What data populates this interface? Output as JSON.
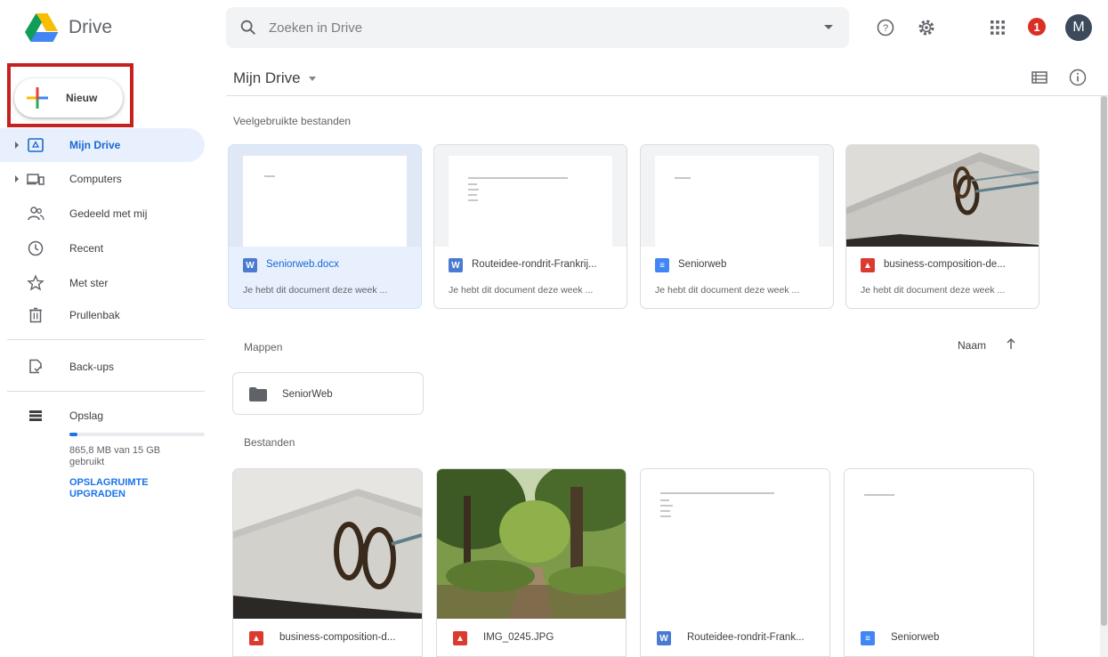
{
  "app": {
    "name": "Drive"
  },
  "search": {
    "placeholder": "Zoeken in Drive"
  },
  "header": {
    "notifications_count": "1",
    "avatar_letter": "M"
  },
  "sidebar": {
    "new_label": "Nieuw",
    "items": [
      {
        "label": "Mijn Drive",
        "icon": "my-drive-icon",
        "active": true
      },
      {
        "label": "Computers",
        "icon": "computers-icon"
      },
      {
        "label": "Gedeeld met mij",
        "icon": "shared-icon"
      },
      {
        "label": "Recent",
        "icon": "clock-icon"
      },
      {
        "label": "Met ster",
        "icon": "star-icon"
      },
      {
        "label": "Prullenbak",
        "icon": "trash-icon"
      },
      {
        "label": "Back-ups",
        "icon": "backup-icon"
      },
      {
        "label": "Opslag",
        "icon": "storage-icon"
      }
    ],
    "storage": {
      "used_text": "865,8 MB van 15 GB gebruikt",
      "fraction": 0.058,
      "upgrade_label": "OPSLAGRUIMTE UPGRADEN"
    }
  },
  "main": {
    "title": "Mijn Drive",
    "quick_access_label": "Veelgebruikte bestanden",
    "quick_access": [
      {
        "name": "Seniorweb.docx",
        "type": "word",
        "subtitle": "Je hebt dit document deze week ...",
        "selected": true
      },
      {
        "name": "Routeidee-rondrit-Frankrij...",
        "type": "word",
        "subtitle": "Je hebt dit document deze week ..."
      },
      {
        "name": "Seniorweb",
        "type": "docs",
        "subtitle": "Je hebt dit document deze week ..."
      },
      {
        "name": "business-composition-de...",
        "type": "image",
        "subtitle": "Je hebt dit document deze week ..."
      }
    ],
    "folders_label": "Mappen",
    "sort_label": "Naam",
    "folders": [
      {
        "name": "SeniorWeb"
      }
    ],
    "files_label": "Bestanden",
    "files": [
      {
        "name": "business-composition-d...",
        "type": "image"
      },
      {
        "name": "IMG_0245.JPG",
        "type": "image"
      },
      {
        "name": "Routeidee-rondrit-Frank...",
        "type": "word"
      },
      {
        "name": "Seniorweb",
        "type": "docs"
      }
    ]
  },
  "colors": {
    "accent": "#1a73e8",
    "active_bg": "#e8f0fe",
    "word": "#4a7bd0",
    "docs": "#4285f4",
    "image": "#db3b2f",
    "highlight_box": "#c5221f"
  }
}
